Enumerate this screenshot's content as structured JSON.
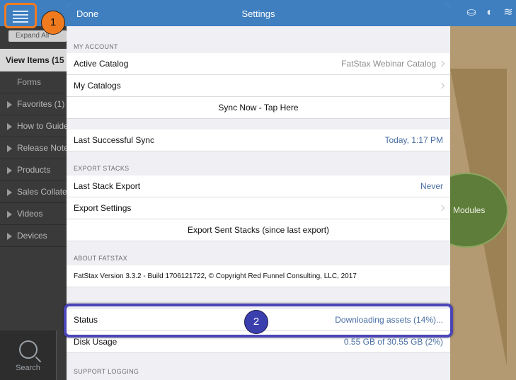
{
  "background_app": {
    "expand_label": "Expand All",
    "view_items": "View Items (15",
    "sidebar_items": [
      {
        "label": "Forms",
        "indent": true
      },
      {
        "label": "Favorites (1)",
        "indent": false
      },
      {
        "label": "How to Guide",
        "indent": false
      },
      {
        "label": "Release Note",
        "indent": false
      },
      {
        "label": "Products",
        "indent": false
      },
      {
        "label": "Sales Collate",
        "indent": false
      },
      {
        "label": "Videos",
        "indent": false
      },
      {
        "label": "Devices",
        "indent": false
      }
    ],
    "search_label": "Search",
    "modules_label": "Modules",
    "icons": [
      "person-icon",
      "contrast-icon",
      "layers-icon"
    ]
  },
  "annotations": {
    "badge_1": "1",
    "badge_2": "2"
  },
  "settings": {
    "done_label": "Done",
    "title": "Settings",
    "my_account": {
      "header": "MY ACCOUNT",
      "active_catalog_label": "Active Catalog",
      "active_catalog_value": "FatStax Webinar Catalog",
      "my_catalogs_label": "My Catalogs",
      "sync_now_label": "Sync Now - Tap Here"
    },
    "last_sync": {
      "label": "Last Successful Sync",
      "value": "Today, 1:17 PM"
    },
    "export_stacks": {
      "header": "EXPORT STACKS",
      "last_export_label": "Last Stack Export",
      "last_export_value": "Never",
      "export_settings_label": "Export Settings",
      "export_sent_label": "Export Sent Stacks (since last export)"
    },
    "about": {
      "header": "ABOUT FATSTAX",
      "version_text": "FatStax Version 3.3.2 - Build 1706121722, © Copyright Red Funnel Consulting, LLC, 2017"
    },
    "asset_download": {
      "status_label": "Status",
      "status_value": "Downloading assets (14%)...",
      "disk_usage_label": "Disk Usage",
      "disk_usage_value": "0.55 GB of 30.55 GB (2%)"
    },
    "support_logging": {
      "header": "SUPPORT LOGGING"
    }
  },
  "colors": {
    "header_blue": "#3f7fc0",
    "highlight_orange": "#f07b1f",
    "highlight_indigo": "#4b45b8"
  }
}
